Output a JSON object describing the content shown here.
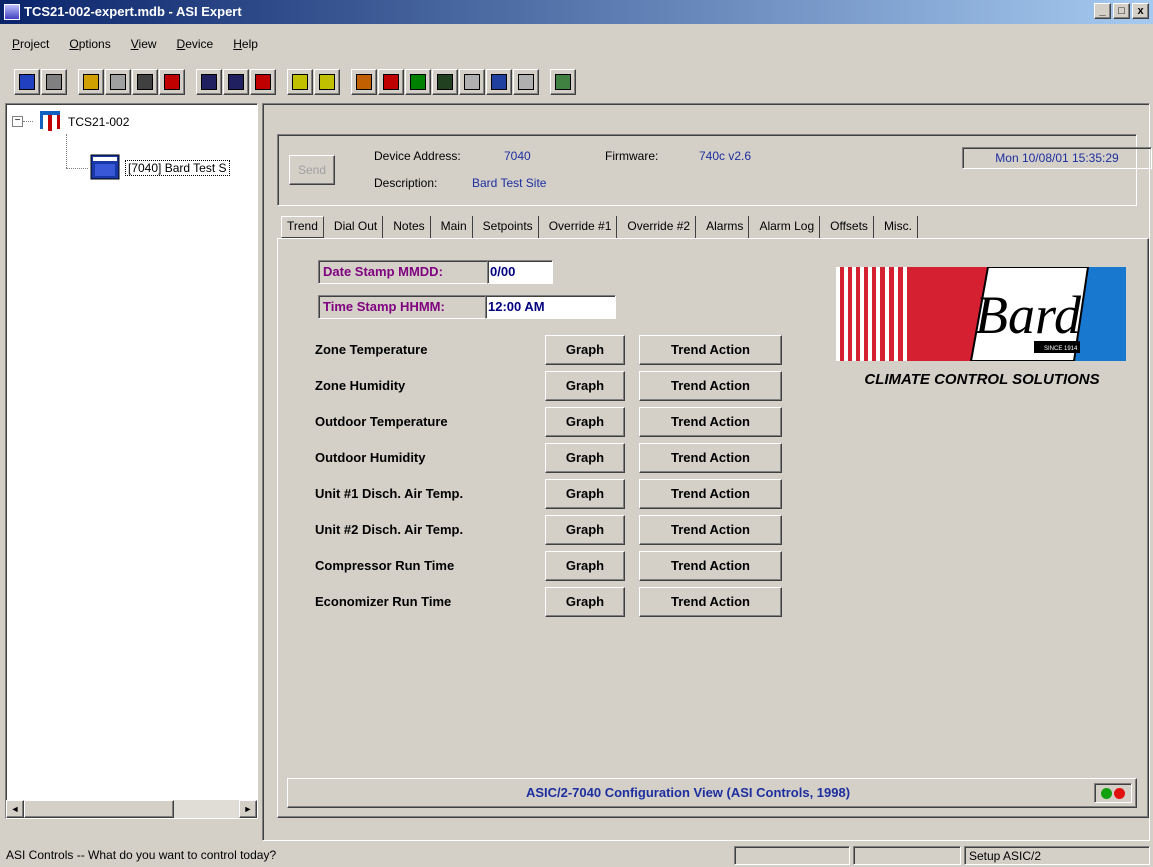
{
  "window": {
    "title": "TCS21-002-expert.mdb - ASI Expert",
    "controls": [
      "_",
      "□",
      "x"
    ]
  },
  "menu": [
    "Project",
    "Options",
    "View",
    "Device",
    "Help"
  ],
  "toolbar": {
    "buttons": [
      {
        "icon": "monitor-icon",
        "color": "#2040c0"
      },
      {
        "icon": "cd-icon",
        "color": "#808080"
      },
      {
        "icon": "gear-yellow-icon",
        "color": "#d0a000"
      },
      {
        "icon": "list-icon",
        "color": "#a0a0a0"
      },
      {
        "icon": "binoculars-icon",
        "color": "#404040"
      },
      {
        "icon": "stop-icon",
        "color": "#c00000"
      },
      {
        "icon": "save-icon",
        "color": "#202060"
      },
      {
        "icon": "save-all-icon",
        "color": "#202060"
      },
      {
        "icon": "save-red-icon",
        "color": "#c00000"
      },
      {
        "icon": "dos-download-icon",
        "color": "#c0c000"
      },
      {
        "icon": "dos-upload-icon",
        "color": "#c0c000"
      },
      {
        "icon": "home-icon",
        "color": "#c06000"
      },
      {
        "icon": "ti-icon",
        "color": "#c00000"
      },
      {
        "icon": "square-green-icon",
        "color": "#008000"
      },
      {
        "icon": "square-dark-icon",
        "color": "#204020"
      },
      {
        "icon": "disabled-icon",
        "color": "#b0b0b0"
      },
      {
        "icon": "grid-icon",
        "color": "#2040a0"
      },
      {
        "icon": "disabled-grid-icon",
        "color": "#b0b0b0"
      },
      {
        "icon": "edit-icon",
        "color": "#408040"
      }
    ]
  },
  "tree": {
    "root": "TCS21-002",
    "child": "[7040] Bard Test S",
    "expander": "−",
    "scroll_left": "◄",
    "scroll_right": "►"
  },
  "device": {
    "send_label": "Send",
    "address_label": "Device Address:",
    "address_value": "7040",
    "firmware_label": "Firmware:",
    "firmware_value": "740c v2.6",
    "description_label": "Description:",
    "description_value": "Bard Test Site",
    "datetime": "Mon  10/08/01  15:35:29"
  },
  "tabs": [
    "Trend",
    "Dial Out",
    "Notes",
    "Main",
    "Setpoints",
    "Override #1",
    "Override #2",
    "Alarms",
    "Alarm Log",
    "Offsets",
    "Misc."
  ],
  "trend": {
    "date_stamp_label": "Date Stamp MMDD:",
    "date_stamp_value": "0/00",
    "time_stamp_label": "Time Stamp HHMM:",
    "time_stamp_value": "12:00 AM",
    "graph_label": "Graph",
    "trend_action_label": "Trend Action",
    "rows": [
      "Zone Temperature",
      "Zone Humidity",
      "Outdoor Temperature",
      "Outdoor Humidity",
      "Unit #1 Disch. Air Temp.",
      "Unit #2 Disch. Air Temp.",
      "Compressor Run Time",
      "Economizer Run Time"
    ]
  },
  "logo": {
    "brand": "Bard",
    "since": "SINCE",
    "year": "1914",
    "tagline": "CLIMATE CONTROL SOLUTIONS",
    "colors": {
      "red": "#d42030",
      "blue": "#1878d0"
    }
  },
  "bottom_caption": "ASIC/2-7040 Configuration View (ASI Controls, 1998)",
  "status_lights": {
    "green": "#10a010",
    "red": "#e01010"
  },
  "statusbar": {
    "message": "ASI Controls -- What do you want to control today?",
    "panel_right": "Setup ASIC/2"
  },
  "accent_colors": {
    "title_start": "#0a246a",
    "title_end": "#a6caf0",
    "label_purple": "#800080",
    "value_blue": "#1c2ea0"
  }
}
